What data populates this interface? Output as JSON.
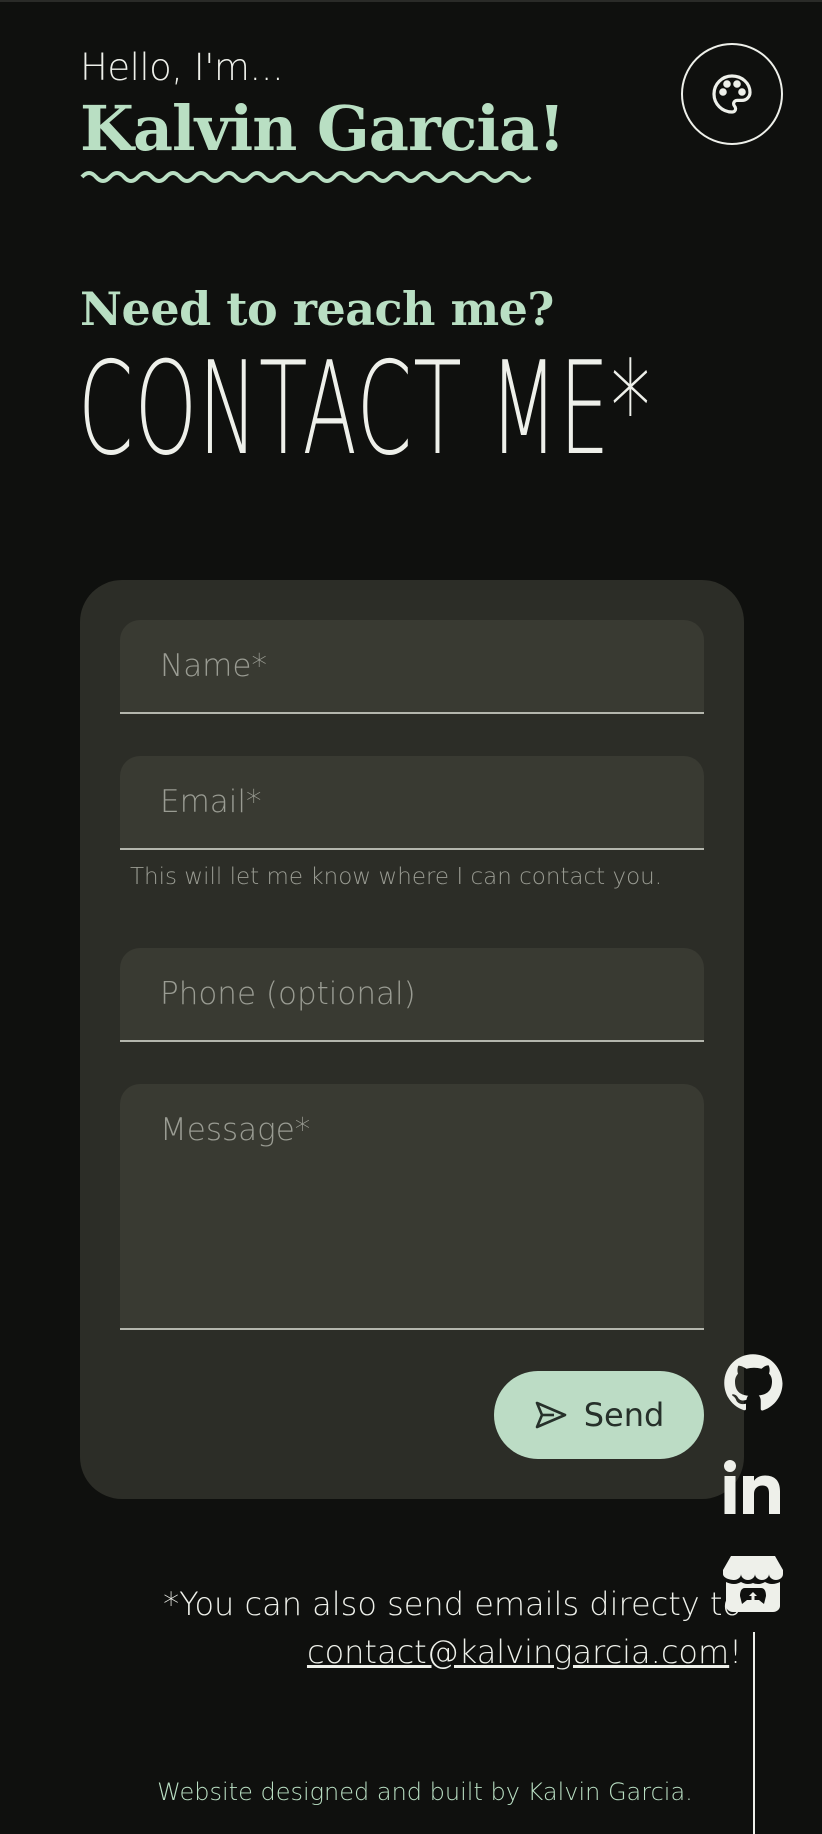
{
  "header": {
    "greeting": "Hello, I'm...",
    "name": "Kalvin Garcia!",
    "theme_button_icon": "palette-icon"
  },
  "section": {
    "subtitle": "Need to reach me?",
    "title": "CONTACT ME*"
  },
  "form": {
    "name_placeholder": "Name*",
    "email_placeholder": "Email*",
    "email_hint": "This will let me know where I can contact you.",
    "phone_placeholder": "Phone (optional)",
    "message_placeholder": "Message*",
    "send_label": "Send",
    "send_icon": "send-icon"
  },
  "footnote": {
    "text": "*You can also send emails directy to",
    "email": "contact@kalvingarcia.com",
    "suffix": "!"
  },
  "social": [
    {
      "name": "github-icon"
    },
    {
      "name": "linkedin-icon"
    },
    {
      "name": "itch-io-icon"
    }
  ],
  "footer": {
    "credit": "Website designed and built by Kalvin Garcia."
  },
  "colors": {
    "background": "#0f100e",
    "accent": "#b9dfc3",
    "card": "#2c2d27",
    "field": "#393a32",
    "text": "#eef0ea"
  }
}
